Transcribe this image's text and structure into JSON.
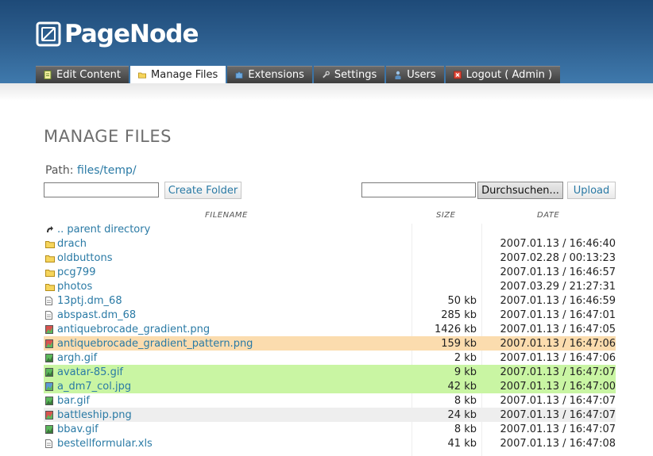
{
  "app": {
    "logo_text": "PageNode"
  },
  "tabs": [
    {
      "label": "Edit Content",
      "icon": "page-icon",
      "active": false
    },
    {
      "label": "Manage Files",
      "icon": "folder-icon",
      "active": true
    },
    {
      "label": "Extensions",
      "icon": "puzzle-icon",
      "active": false
    },
    {
      "label": "Settings",
      "icon": "wrench-icon",
      "active": false
    },
    {
      "label": "Users",
      "icon": "user-icon",
      "active": false
    },
    {
      "label": "Logout ( Admin )",
      "icon": "logout-icon",
      "active": false
    }
  ],
  "page": {
    "title": "MANAGE FILES",
    "path_label": "Path:",
    "path_value": "files/temp/"
  },
  "folder_form": {
    "input_value": "",
    "button_label": "Create Folder"
  },
  "upload_form": {
    "input_value": "",
    "browse_label": "Durchsuchen...",
    "upload_label": "Upload"
  },
  "table": {
    "headers": {
      "filename": "FILENAME",
      "size": "SIZE",
      "date": "DATE"
    },
    "rows": [
      {
        "icon": "parent-dir-icon",
        "name": ".. parent directory",
        "size": "",
        "date": "",
        "highlight": ""
      },
      {
        "icon": "folder-icon",
        "name": "drach",
        "size": "",
        "date": "2007.01.13 / 16:46:40",
        "highlight": ""
      },
      {
        "icon": "folder-icon",
        "name": "oldbuttons",
        "size": "",
        "date": "2007.02.28 / 00:13:23",
        "highlight": ""
      },
      {
        "icon": "folder-icon",
        "name": "pcg799",
        "size": "",
        "date": "2007.01.13 / 16:46:57",
        "highlight": ""
      },
      {
        "icon": "folder-icon",
        "name": "photos",
        "size": "",
        "date": "2007.03.29 / 21:27:31",
        "highlight": ""
      },
      {
        "icon": "file-icon",
        "name": "13ptj.dm_68",
        "size": "50 kb",
        "date": "2007.01.13 / 16:46:59",
        "highlight": ""
      },
      {
        "icon": "file-icon",
        "name": "abspast.dm_68",
        "size": "285 kb",
        "date": "2007.01.13 / 16:47:01",
        "highlight": ""
      },
      {
        "icon": "image-red-icon",
        "name": "antiquebrocade_gradient.png",
        "size": "1426 kb",
        "date": "2007.01.13 / 16:47:05",
        "highlight": ""
      },
      {
        "icon": "image-red-icon",
        "name": "antiquebrocade_gradient_pattern.png",
        "size": "159 kb",
        "date": "2007.01.13 / 16:47:06",
        "highlight": "orange"
      },
      {
        "icon": "image-green-icon",
        "name": "argh.gif",
        "size": "2 kb",
        "date": "2007.01.13 / 16:47:06",
        "highlight": ""
      },
      {
        "icon": "image-green-icon",
        "name": "avatar-85.gif",
        "size": "9 kb",
        "date": "2007.01.13 / 16:47:07",
        "highlight": "green"
      },
      {
        "icon": "image-blue-icon",
        "name": "a_dm7_col.jpg",
        "size": "42 kb",
        "date": "2007.01.13 / 16:47:00",
        "highlight": "green"
      },
      {
        "icon": "image-green-icon",
        "name": "bar.gif",
        "size": "8 kb",
        "date": "2007.01.13 / 16:47:07",
        "highlight": ""
      },
      {
        "icon": "image-red-icon",
        "name": "battleship.png",
        "size": "24 kb",
        "date": "2007.01.13 / 16:47:07",
        "highlight": "gray"
      },
      {
        "icon": "image-green-icon",
        "name": "bbav.gif",
        "size": "8 kb",
        "date": "2007.01.13 / 16:47:07",
        "highlight": ""
      },
      {
        "icon": "file-icon",
        "name": "bestellformular.xls",
        "size": "41 kb",
        "date": "2007.01.13 / 16:47:08",
        "highlight": ""
      }
    ]
  },
  "colors": {
    "header_top": "#1e4a78",
    "header_bottom": "#3f79ac",
    "link": "#2a7aa5",
    "row_orange": "#fbdcae",
    "row_green": "#c9f5a3",
    "row_gray": "#eeeeee"
  }
}
